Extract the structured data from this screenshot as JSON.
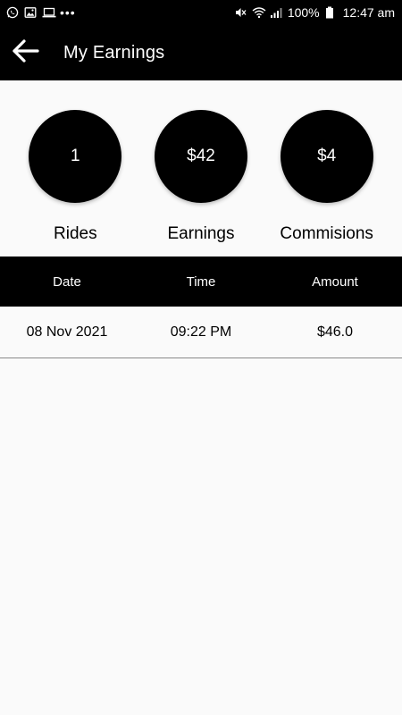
{
  "status_bar": {
    "battery": "100%",
    "time": "12:47 am"
  },
  "header": {
    "title": "My Earnings",
    "back_icon": "arrow-left-icon"
  },
  "stats": [
    {
      "value": "1",
      "label": "Rides"
    },
    {
      "value": "$42",
      "label": "Earnings"
    },
    {
      "value": "$4",
      "label": "Commisions"
    }
  ],
  "table": {
    "columns": [
      "Date",
      "Time",
      "Amount"
    ],
    "rows": [
      {
        "date": "08 Nov 2021",
        "time": "09:22 PM",
        "amount": "$46.0"
      }
    ]
  },
  "colors": {
    "primary": "#000000",
    "background": "#fafafa",
    "text_on_primary": "#ffffff"
  }
}
